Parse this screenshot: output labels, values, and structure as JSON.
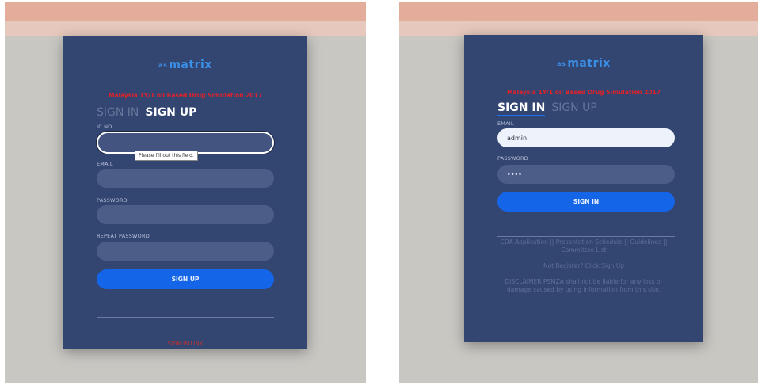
{
  "left_panel": {
    "logo_prefix": "as",
    "logo": "matrix",
    "subtitle": "Malaysia 1Y/1 oil Based Drug Simulation 2017",
    "tab_sign_in": "SIGN IN",
    "tab_sign_up": "SIGN UP",
    "ic_label": "IC NO",
    "email_label": "EMAIL",
    "password_label": "PASSWORD",
    "repeat_password_label": "REPEAT PASSWORD",
    "tooltip": "Please fill out this field.",
    "signup_button": "SIGN UP",
    "footer_link": "SIGN IN LINK"
  },
  "right_panel": {
    "logo_prefix": "as",
    "logo": "matrix",
    "subtitle": "Malaysia 1Y/1 oil Based Drug Simulation 2017",
    "tab_sign_in": "SIGN IN",
    "tab_sign_up": "SIGN UP",
    "email_label": "EMAIL",
    "email_value": "admin",
    "password_label": "PASSWORD",
    "password_value": "••••",
    "signin_button": "SIGN IN",
    "links": "CDA Application || Presentation Schedule || Guidelines || Committee List",
    "not_registered": "Not Register? Click Sign Up",
    "disclaimer": "DISCLAIMER PSMZA shall not be liable for any loss or damage caused by using information from this site."
  },
  "colors": {
    "card": "#334571",
    "accent": "#1565e8",
    "error_red": "#e0232a",
    "topbar": "#e4ad9b"
  }
}
